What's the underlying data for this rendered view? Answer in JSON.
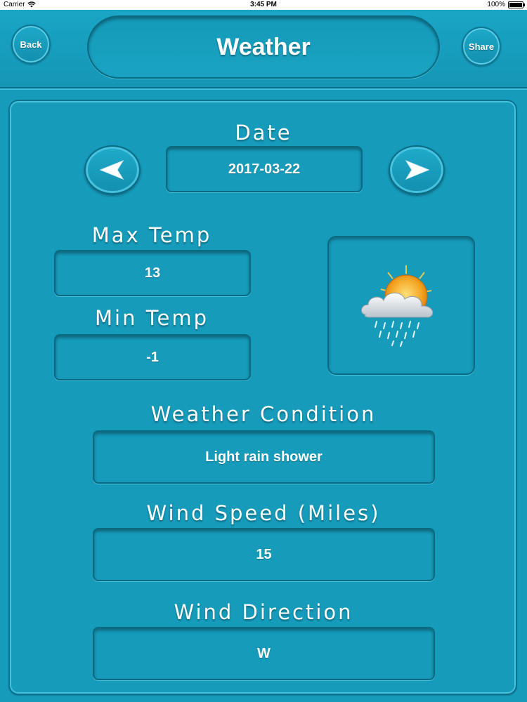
{
  "status_bar": {
    "carrier": "Carrier",
    "time": "3:45 PM",
    "battery": "100%",
    "battery_level": 1.0
  },
  "header": {
    "back_label": "Back",
    "title": "Weather",
    "share_label": "Share"
  },
  "date": {
    "label": "Date",
    "value": "2017-03-22",
    "prev_icon": "arrow-left-icon",
    "next_icon": "arrow-right-icon"
  },
  "max_temp": {
    "label": "Max Temp",
    "value": "13"
  },
  "min_temp": {
    "label": "Min Temp",
    "value": "-1"
  },
  "weather_icon": "sun-cloud-rain-icon",
  "condition": {
    "label": "Weather Condition",
    "value": "Light rain shower"
  },
  "wind_speed": {
    "label": "Wind Speed (Miles)",
    "value": "15"
  },
  "wind_direction": {
    "label": "Wind Direction",
    "value": "W"
  },
  "colors": {
    "background": "#169bbb",
    "border_dark": "#0a6a82",
    "highlight": "#45c4e0",
    "text": "#ffffff"
  }
}
